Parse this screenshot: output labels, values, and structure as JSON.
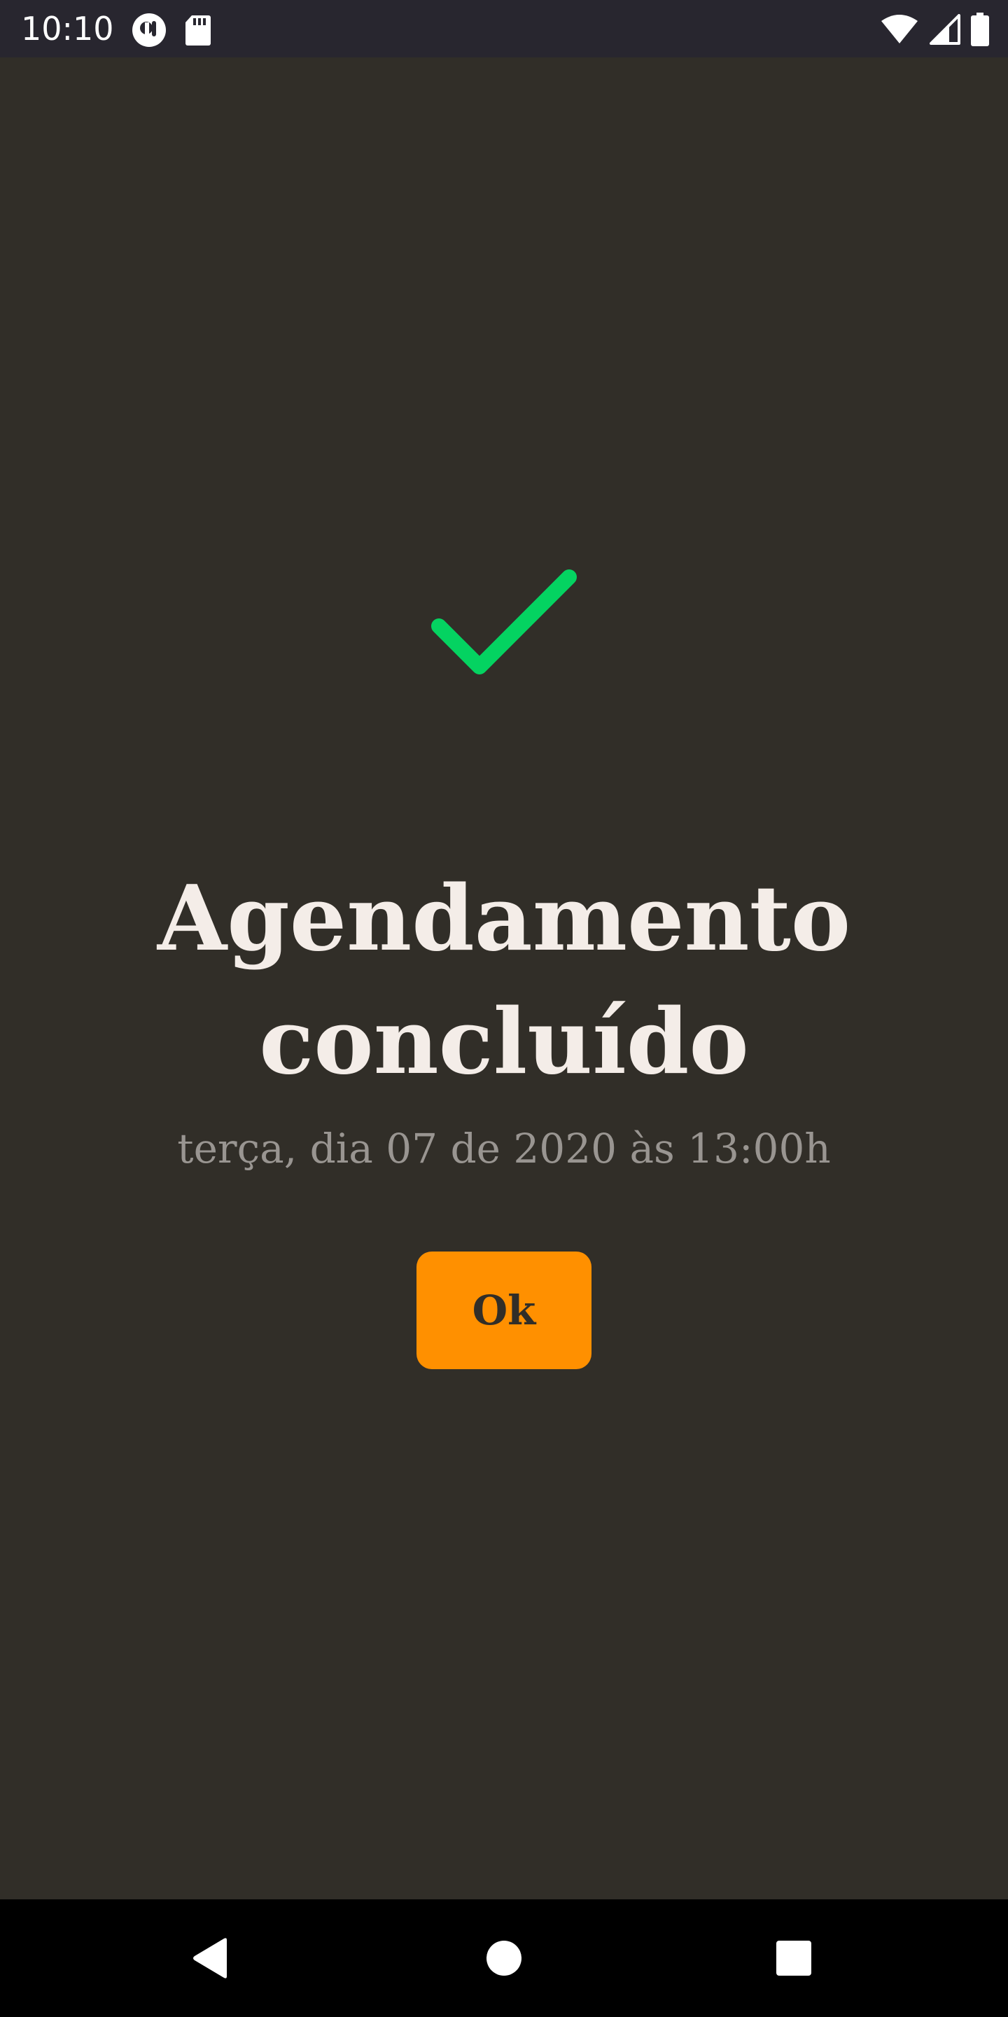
{
  "status_bar": {
    "time": "10:10",
    "icons_left": [
      "app-notification-icon",
      "sd-card-icon"
    ],
    "icons_right": [
      "wifi-icon",
      "cell-signal-icon",
      "battery-icon"
    ]
  },
  "confirmation": {
    "icon": "check-icon",
    "title": "Agendamento\nconcluído",
    "subtitle": "terça, dia 07 de 2020 às 13:00h",
    "ok_label": "Ok"
  },
  "nav_bar": {
    "buttons": [
      "back-icon",
      "home-icon",
      "recents-icon"
    ]
  },
  "colors": {
    "background": "#312e28",
    "status_bar": "#28262f",
    "accent": "#ff9000",
    "success": "#04d361",
    "title_text": "#f4ede8",
    "subtitle_text": "#999591"
  }
}
